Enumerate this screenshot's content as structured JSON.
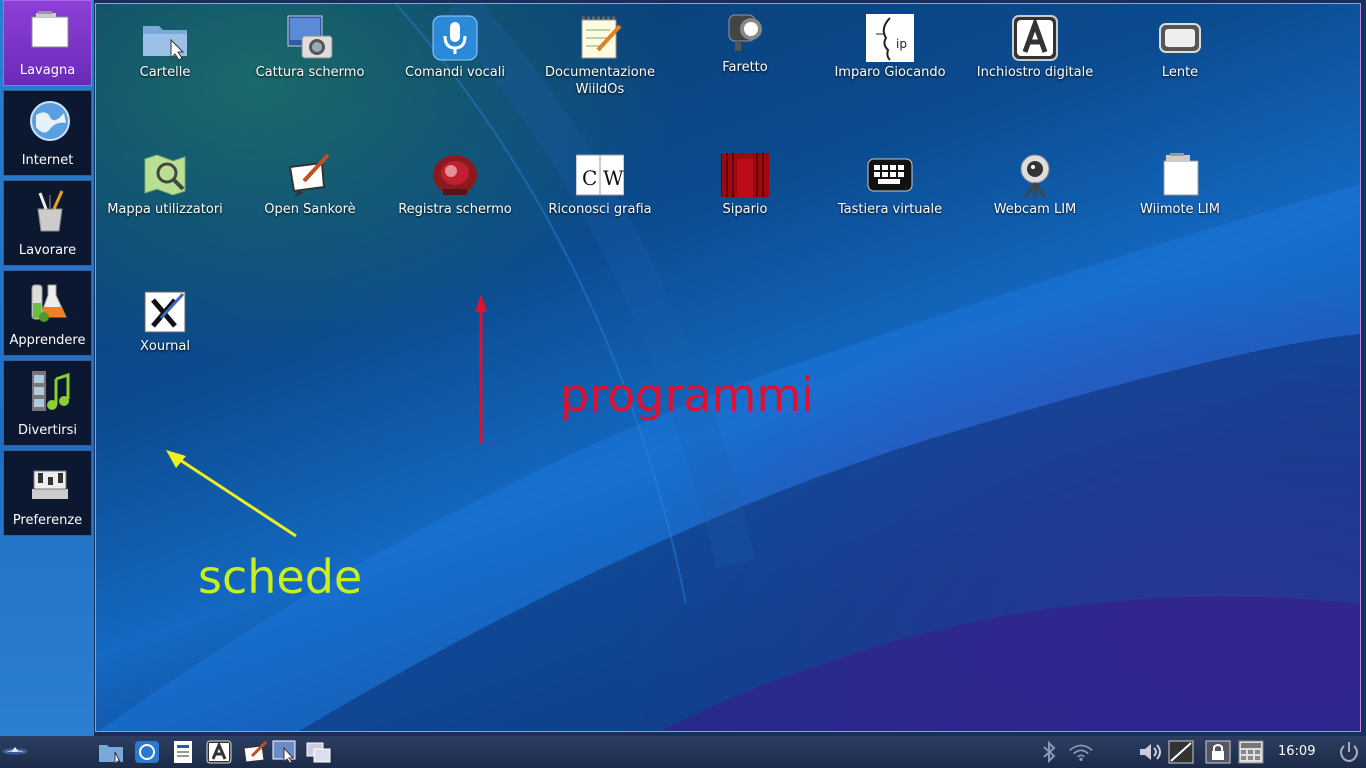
{
  "sidebar": {
    "tabs": [
      {
        "label": "Lavagna",
        "icon": "whiteboard-icon"
      },
      {
        "label": "Internet",
        "icon": "globe-icon"
      },
      {
        "label": "Lavorare",
        "icon": "pencil-cup-icon"
      },
      {
        "label": "Apprendere",
        "icon": "flask-icon"
      },
      {
        "label": "Divertirsi",
        "icon": "film-music-icon"
      },
      {
        "label": "Preferenze",
        "icon": "mixer-icon"
      }
    ],
    "active_tab": "Lavagna"
  },
  "desktop": {
    "icons": [
      {
        "label": "Cartelle",
        "icon": "folder-icon"
      },
      {
        "label": "Cattura schermo",
        "icon": "camera-icon"
      },
      {
        "label": "Comandi vocali",
        "icon": "microphone-icon"
      },
      {
        "label": "Documentazione WiildOs",
        "icon": "notepad-icon"
      },
      {
        "label": "Faretto",
        "icon": "spotlight-icon"
      },
      {
        "label": "Imparo Giocando",
        "icon": "face-logo-icon"
      },
      {
        "label": "Inchiostro digitale",
        "icon": "letter-a-icon"
      },
      {
        "label": "Lente",
        "icon": "magnifier-icon"
      },
      {
        "label": "Mappa utilizzatori",
        "icon": "map-icon"
      },
      {
        "label": "Open Sankorè",
        "icon": "board-pen-icon"
      },
      {
        "label": "Registra schermo",
        "icon": "record-icon"
      },
      {
        "label": "Riconosci grafia",
        "icon": "cw-icon"
      },
      {
        "label": "Sipario",
        "icon": "curtain-icon"
      },
      {
        "label": "Tastiera virtuale",
        "icon": "keyboard-icon"
      },
      {
        "label": "Webcam LIM",
        "icon": "webcam-icon"
      },
      {
        "label": "Wiimote LIM",
        "icon": "wiimote-icon"
      },
      {
        "label": "Xournal",
        "icon": "xournal-icon"
      }
    ]
  },
  "annotations": {
    "tabs_label": "schede",
    "programs_label": "programmi",
    "colors": {
      "tabs": "#c8f01e",
      "programs": "#e01030",
      "arrow_yellow": "#f0f020",
      "arrow_red": "#e01030"
    }
  },
  "taskbar": {
    "launchers": [
      "start-menu-icon",
      "file-manager-icon",
      "browser-icon",
      "document-icon",
      "ink-icon",
      "sankore-icon",
      "screenshot-icon",
      "windows-icon"
    ],
    "tray": [
      "bluetooth-icon",
      "wifi-icon",
      "volume-icon",
      "screen-icon",
      "lock-icon",
      "calculator-icon",
      "power-icon"
    ],
    "clock": "16:09"
  },
  "colors": {
    "active_tab": "#7a35c8",
    "tab_bg": "#0c1730",
    "sidebar_bg": "#2a7fd0",
    "taskbar_bg": "#22324f"
  }
}
